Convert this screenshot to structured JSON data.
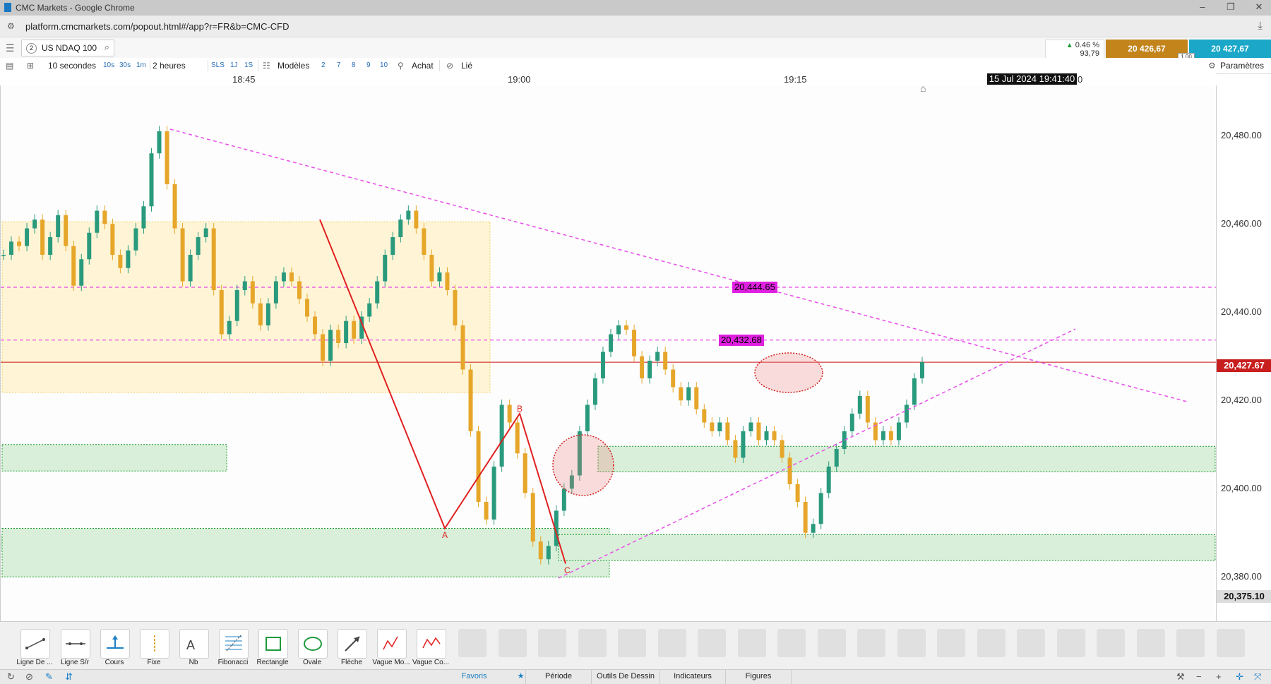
{
  "window": {
    "title": "CMC Markets - Google Chrome",
    "url": "platform.cmcmarkets.com/popout.html#/app?r=FR&b=CMC-CFD"
  },
  "instrument": {
    "tab_number": "2",
    "name": "US NDAQ 100",
    "change_pct": "0.46 %",
    "change_pts": "93,79",
    "sell_price": "20 426,67",
    "buy_price": "20 427,67",
    "spread": "1.00"
  },
  "toolbar": {
    "interval": "10 secondes",
    "quick_intervals": [
      "10s",
      "30s",
      "1m"
    ],
    "span": "2 heures",
    "quick_spans": [
      "SLS",
      "1J",
      "1S"
    ],
    "templates_label": "Modèles",
    "template_slots": [
      "2",
      "7",
      "8",
      "9",
      "10"
    ],
    "buy_label": "Achat",
    "linked_label": "Lié",
    "settings_label": "Paramètres"
  },
  "time_axis": {
    "labels": [
      "18:45",
      "19:00",
      "19:15"
    ],
    "crosshair_time": "15 Jul 2024 19:41:40",
    "crosshair_suffix": "0"
  },
  "price_axis": {
    "labels": [
      "20,480.00",
      "20,460.00",
      "20,440.00",
      "20,420.00",
      "20,400.00",
      "20,380.00"
    ],
    "current_price_tag": "20,427.67",
    "low_price_tag": "20,375.10"
  },
  "chart_tags": {
    "level_1": "20,444.65",
    "level_2": "20,432.68"
  },
  "wave_labels": {
    "a": "A",
    "b": "B",
    "c": "C"
  },
  "colors": {
    "sell": "#c3841c",
    "buy": "#1ba7c8",
    "candle": "#e6a62a",
    "candle_up": "#2a9a7d",
    "trendline": "#e84ee8",
    "current_line": "#cc1111",
    "supply_zone": "#fff5d6",
    "demand_zone": "#d9efd9"
  },
  "chart_data": {
    "type": "candlestick",
    "title": "",
    "xlabel": "",
    "ylabel": "",
    "ylim": [
      20375.1,
      20482
    ],
    "x_ticks": [
      "18:45",
      "19:00",
      "19:15"
    ],
    "y_ticks": [
      20480,
      20460,
      20440,
      20420,
      20400,
      20380
    ],
    "current_price": 20427.67,
    "horizontal_levels": [
      20444.65,
      20432.68,
      20427.67
    ],
    "close_series": [
      20452,
      20455,
      20454,
      20458,
      20460,
      20452,
      20456,
      20461,
      20454,
      20445,
      20451,
      20457,
      20462,
      20459,
      20452,
      20449,
      20453,
      20458,
      20463,
      20475,
      20480,
      20468,
      20458,
      20446,
      20452,
      20456,
      20458,
      20444,
      20434,
      20437,
      20444,
      20446,
      20441,
      20436,
      20441,
      20446,
      20448,
      20446,
      20442,
      20438,
      20434,
      20428,
      20435,
      20432,
      20437,
      20433,
      20438,
      20441,
      20446,
      20452,
      20456,
      20460,
      20462,
      20458,
      20452,
      20446,
      20448,
      20444,
      20436,
      20426,
      20412,
      20396,
      20392,
      20404,
      20418,
      20414,
      20407,
      20398,
      20387,
      20383,
      20386,
      20394,
      20399,
      20402,
      20412,
      20418,
      20424,
      20430,
      20434,
      20436,
      20435,
      20429,
      20424,
      20428,
      20430,
      20426,
      20422,
      20419,
      20422,
      20417,
      20414,
      20412,
      20414,
      20410,
      20406,
      20412,
      20414,
      20410,
      20412,
      20410,
      20406,
      20400,
      20396,
      20389,
      20391,
      20398,
      20404,
      20408,
      20412,
      20416,
      20420,
      20414,
      20410,
      20412,
      20410,
      20414,
      20418,
      20424,
      20427.67
    ],
    "zones": [
      {
        "kind": "supply",
        "from": 20420.8,
        "to": 20459.5
      },
      {
        "kind": "demand",
        "from": 20403.0,
        "to": 20409.0
      },
      {
        "kind": "demand",
        "from": 20384.7,
        "to": 20388.3
      },
      {
        "kind": "demand",
        "from": 20379.0,
        "to": 20390.0
      },
      {
        "kind": "demand",
        "from": 20402.8,
        "to": 20408.6
      },
      {
        "kind": "demand",
        "from": 20382.7,
        "to": 20388.6
      }
    ],
    "abc_wave": [
      {
        "label": "",
        "price": 20460
      },
      {
        "label": "A",
        "price": 20390
      },
      {
        "label": "B",
        "price": 20416
      },
      {
        "label": "C",
        "price": 20382
      }
    ]
  },
  "drawing_tools": [
    {
      "label": "Ligne De ...",
      "icon": "line-tool-icon"
    },
    {
      "label": "Ligne S/r",
      "icon": "sr-line-icon"
    },
    {
      "label": "Cours",
      "icon": "price-marker-icon"
    },
    {
      "label": "Fixe",
      "icon": "fixed-icon"
    },
    {
      "label": "Nb",
      "icon": "text-icon"
    },
    {
      "label": "Fibonacci",
      "icon": "fibonacci-icon"
    },
    {
      "label": "Rectangle",
      "icon": "rectangle-icon"
    },
    {
      "label": "Ovale",
      "icon": "oval-icon"
    },
    {
      "label": "Flèche",
      "icon": "arrow-icon"
    },
    {
      "label": "Vague Mo...",
      "icon": "wave-mo-icon"
    },
    {
      "label": "Vague Co...",
      "icon": "wave-co-icon"
    }
  ],
  "bottom_tabs": [
    {
      "label": "Favoris"
    },
    {
      "label": "Période"
    },
    {
      "label": "Outils De Dessin"
    },
    {
      "label": "Indicateurs"
    },
    {
      "label": "Figures"
    }
  ]
}
